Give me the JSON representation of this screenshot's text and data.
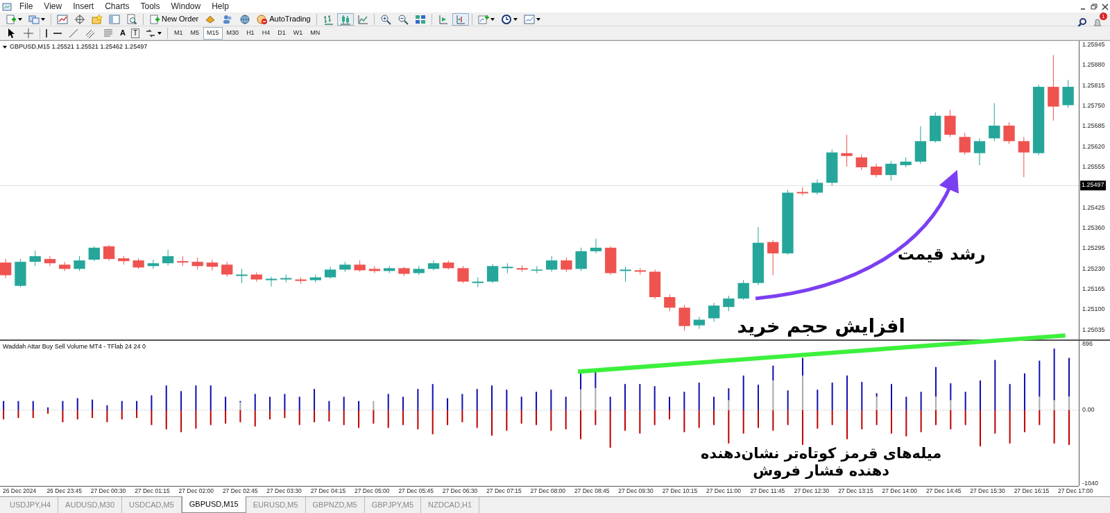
{
  "menu": [
    "File",
    "View",
    "Insert",
    "Charts",
    "Tools",
    "Window",
    "Help"
  ],
  "notifications": {
    "count": "1"
  },
  "toolbar": {
    "new_order": "New Order",
    "auto_trading": "AutoTrading",
    "chart_types": [
      {
        "kind": "bars",
        "selected": false
      },
      {
        "kind": "candles",
        "selected": true
      },
      {
        "kind": "line",
        "selected": false
      }
    ],
    "autoscroll_on": false,
    "chart_shift_on": true
  },
  "drawing_tools": {
    "text_tool": "A",
    "label_tool": "T"
  },
  "timeframes": [
    {
      "label": "M1",
      "selected": false
    },
    {
      "label": "M5",
      "selected": false
    },
    {
      "label": "M15",
      "selected": true
    },
    {
      "label": "M30",
      "selected": false
    },
    {
      "label": "H1",
      "selected": false
    },
    {
      "label": "H4",
      "selected": false
    },
    {
      "label": "D1",
      "selected": false
    },
    {
      "label": "W1",
      "selected": false
    },
    {
      "label": "MN",
      "selected": false
    }
  ],
  "chart": {
    "symbol_info": "GBPUSD,M15  1.25521 1.25521 1.25462 1.25497",
    "price_ticks": [
      "1.25945",
      "1.25880",
      "1.25815",
      "1.25750",
      "1.25685",
      "1.25620",
      "1.25555",
      "1.25425",
      "1.25360",
      "1.25295",
      "1.25230",
      "1.25165",
      "1.25100",
      "1.25035"
    ],
    "current_price": "1.25497",
    "indicator_label": "Waddah Attar Buy Sell Volume MT4 - TFlab 24 24 0",
    "indicator_ticks": [
      "896",
      "0.00",
      "-1040"
    ],
    "time_labels": [
      "26 Dec 2024",
      "26 Dec 23:45",
      "27 Dec 00:30",
      "27 Dec 01:15",
      "27 Dec 02:00",
      "27 Dec 02:45",
      "27 Dec 03:30",
      "27 Dec 04:15",
      "27 Dec 05:00",
      "27 Dec 05:45",
      "27 Dec 06:30",
      "27 Dec 07:15",
      "27 Dec 08:00",
      "27 Dec 08:45",
      "27 Dec 09:30",
      "27 Dec 10:15",
      "27 Dec 11:00",
      "27 Dec 11:45",
      "27 Dec 12:30",
      "27 Dec 13:15",
      "27 Dec 14:00",
      "27 Dec 14:45",
      "27 Dec 15:30",
      "27 Dec 16:15",
      "27 Dec 17:00"
    ]
  },
  "annotations": [
    {
      "kind": "price",
      "text": "رشد قیمت"
    },
    {
      "kind": "volume",
      "text": "افزایش حجم خرید"
    },
    {
      "kind": "note",
      "lines": [
        "میله‌های قرمز کوتاه‌تر نشان‌دهنده",
        "دهنده فشار فروش"
      ]
    }
  ],
  "tabs": [
    {
      "label": "USDJPY,H4",
      "selected": false
    },
    {
      "label": "AUDUSD,M30",
      "selected": false
    },
    {
      "label": "USDCAD,M5",
      "selected": false
    },
    {
      "label": "GBPUSD,M15",
      "selected": true
    },
    {
      "label": "EURUSD,M5",
      "selected": false
    },
    {
      "label": "GBPNZD,M5",
      "selected": false
    },
    {
      "label": "GBPJPY,M5",
      "selected": false
    },
    {
      "label": "NZDCAD,H1",
      "selected": false
    }
  ]
}
